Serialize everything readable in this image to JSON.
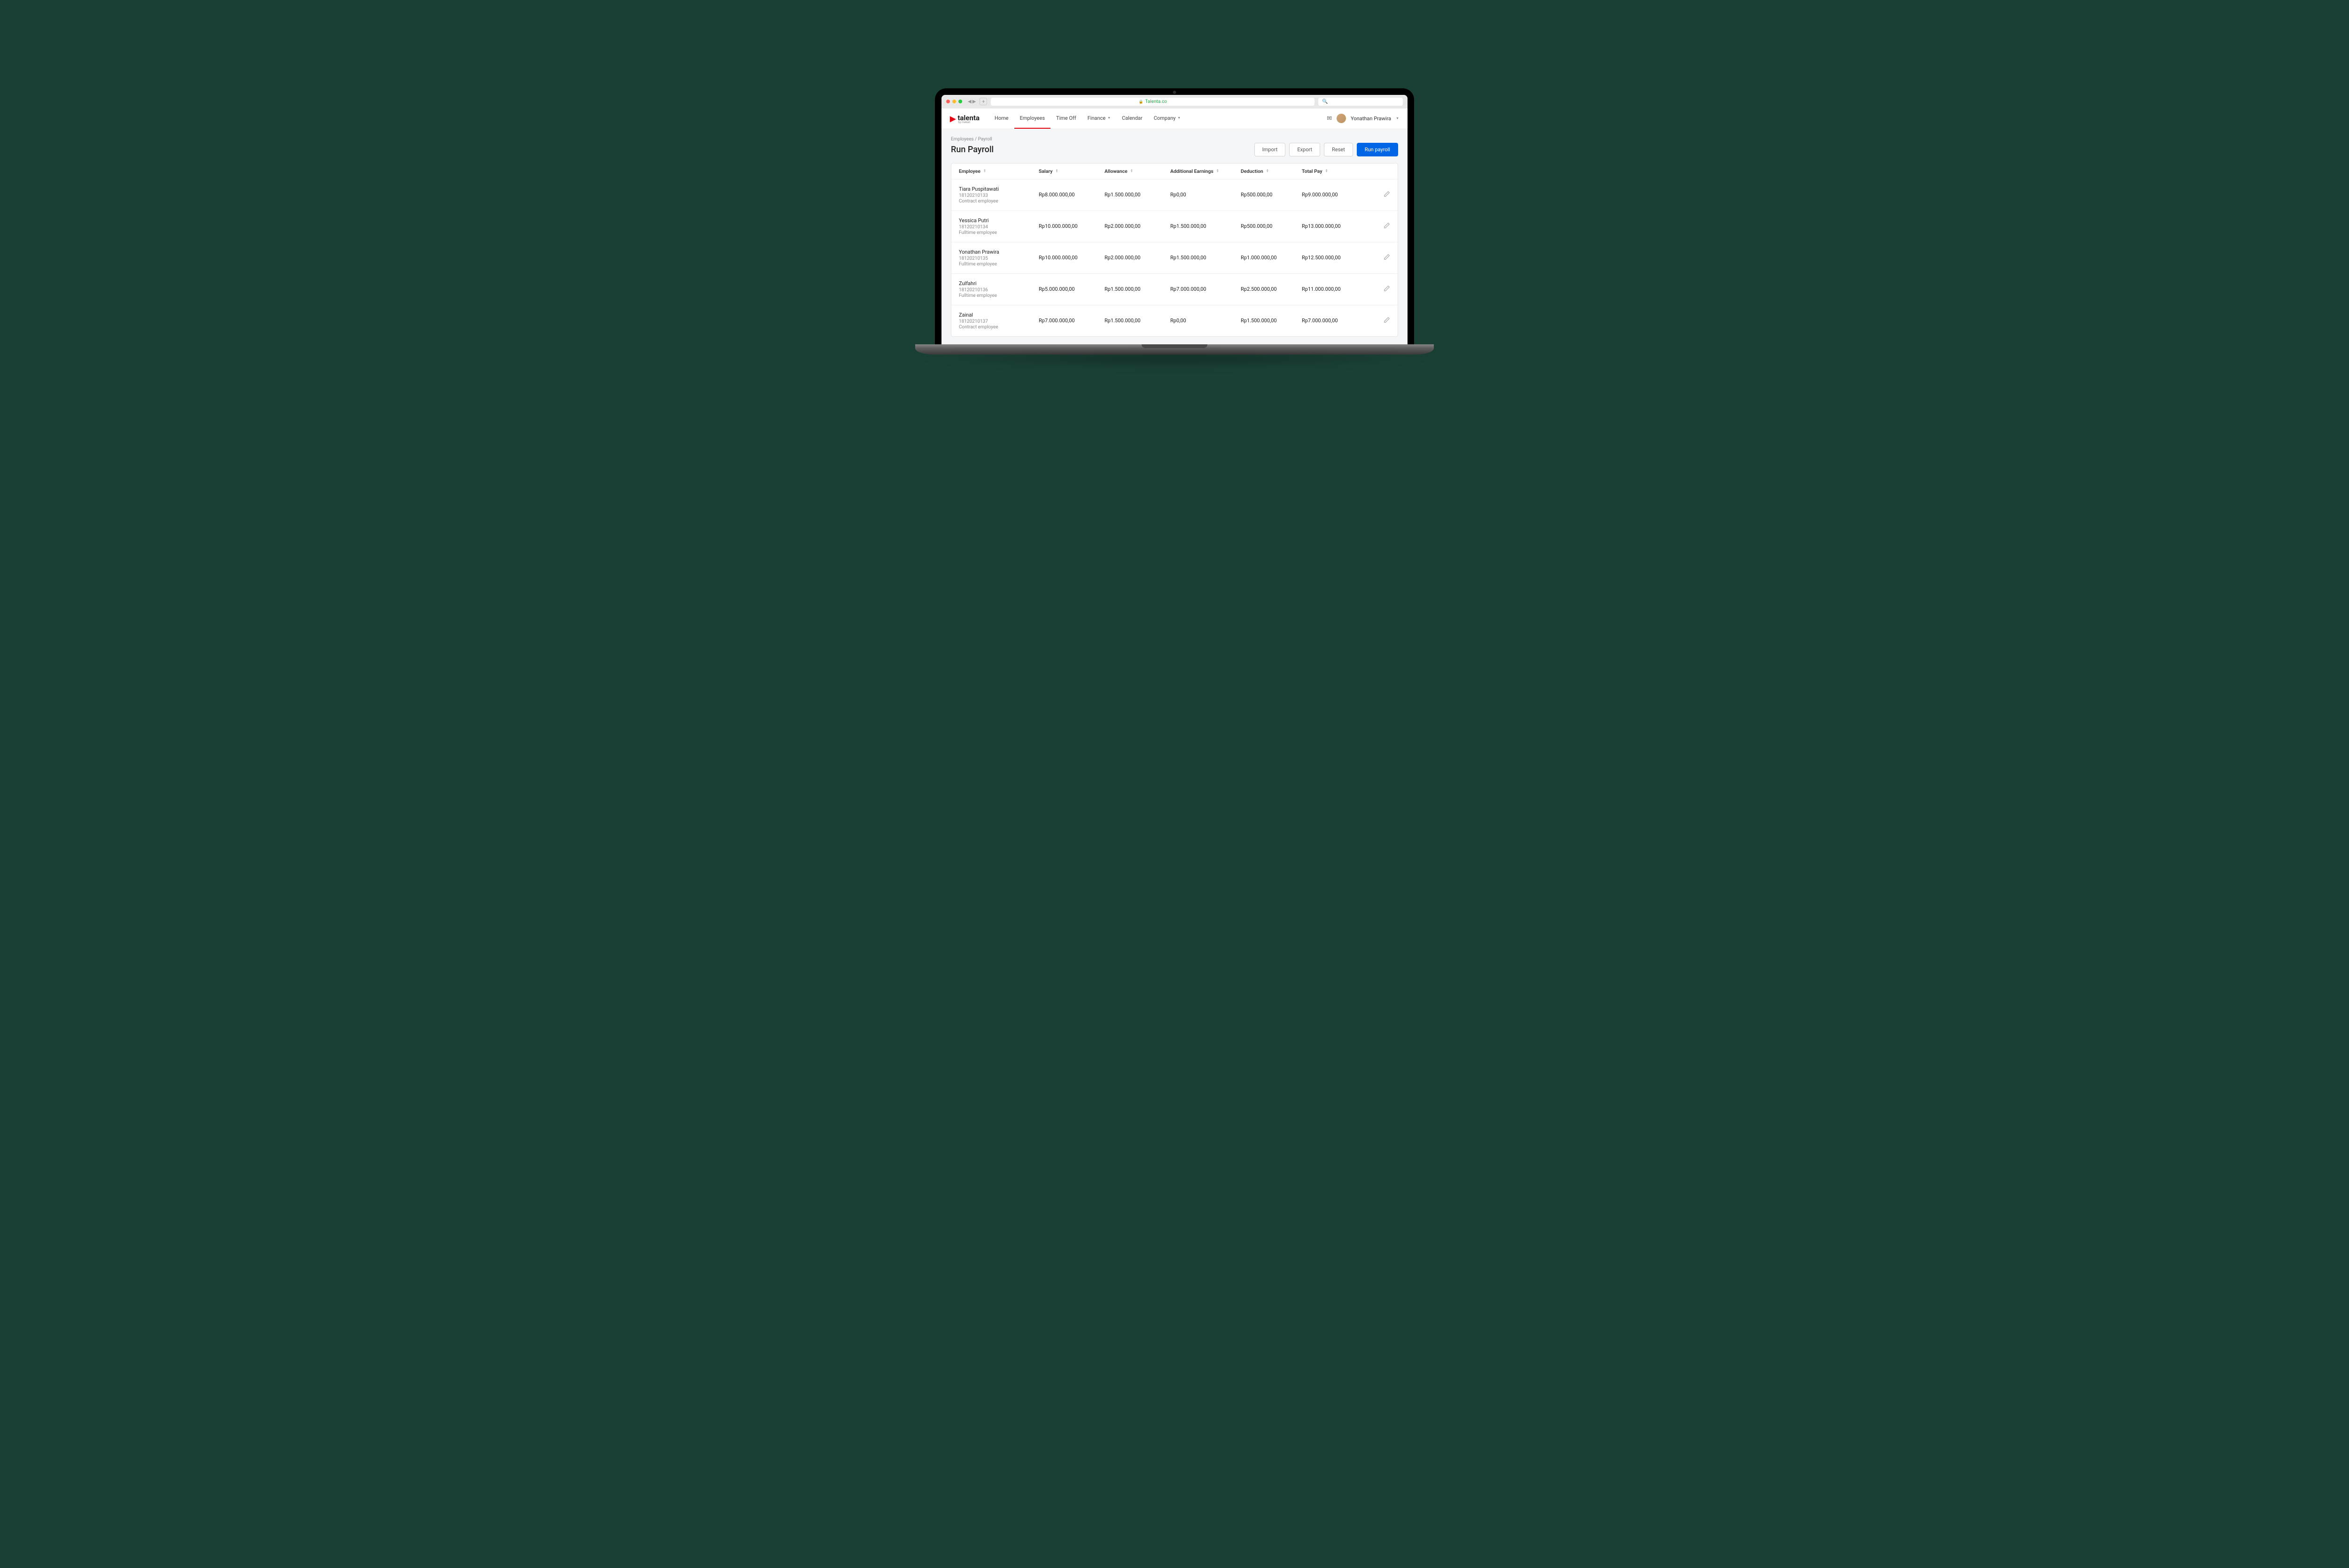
{
  "browser": {
    "url": "Talenta.co",
    "search_placeholder": "Search"
  },
  "brand": {
    "name": "talenta",
    "sub": "by mekari"
  },
  "nav": {
    "items": [
      {
        "label": "Home"
      },
      {
        "label": "Employees"
      },
      {
        "label": "Time Off"
      },
      {
        "label": "Finance"
      },
      {
        "label": "Calendar"
      },
      {
        "label": "Company"
      }
    ]
  },
  "user": {
    "name": "Yonathan Prawira"
  },
  "breadcrumb": "Employees / Payroll",
  "page_title": "Run Payroll",
  "actions": {
    "import": "Import",
    "export": "Export",
    "reset": "Reset",
    "run": "Run payroll"
  },
  "columns": {
    "employee": "Employee",
    "salary": "Salary",
    "allowance": "Allowance",
    "additional": "Additional Earnings",
    "deduction": "Deduction",
    "total": "Total Pay"
  },
  "rows": [
    {
      "name": "Tiara Puspitawati",
      "id": "18120210133",
      "type": "Contract employee",
      "salary": "Rp8.000.000,00",
      "allowance": "Rp1.500.000,00",
      "additional": "Rp0,00",
      "deduction": "Rp500.000,00",
      "total": "Rp9.000.000,00"
    },
    {
      "name": "Yessica Putri",
      "id": "18120210134",
      "type": "Fulltime employee",
      "salary": "Rp10.000.000,00",
      "allowance": "Rp2.000.000,00",
      "additional": "Rp1.500.000,00",
      "deduction": "Rp500.000,00",
      "total": "Rp13.000.000,00"
    },
    {
      "name": "Yonathan Prawira",
      "id": "18120210135",
      "type": "Fulltime employee",
      "salary": "Rp10.000.000,00",
      "allowance": "Rp2.000.000,00",
      "additional": "Rp1.500.000,00",
      "deduction": "Rp1.000.000,00",
      "total": "Rp12.500.000,00"
    },
    {
      "name": "Zulfahri",
      "id": "18120210136",
      "type": "Fulltime employee",
      "salary": "Rp5.000.000,00",
      "allowance": "Rp1.500.000,00",
      "additional": "Rp7.000.000,00",
      "deduction": "Rp2.500.000,00",
      "total": "Rp11.000.000,00"
    },
    {
      "name": "Zainal",
      "id": "18120210137",
      "type": "Contract employee",
      "salary": "Rp7.000.000,00",
      "allowance": "Rp1.500.000,00",
      "additional": "Rp0,00",
      "deduction": "Rp1.500.000,00",
      "total": "Rp7.000.000,00"
    }
  ]
}
